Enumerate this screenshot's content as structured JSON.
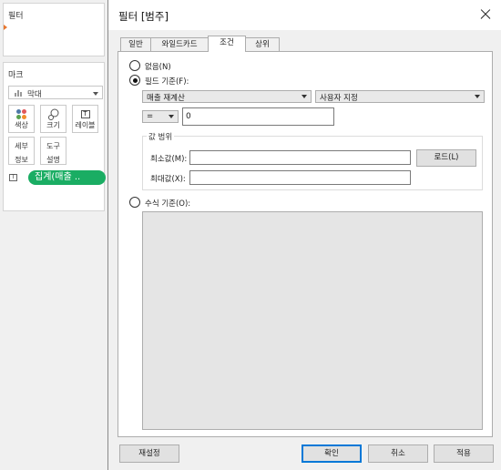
{
  "left": {
    "filter_title": "필터",
    "marks_title": "마크",
    "mark_type": "막대",
    "buttons": {
      "color": "색상",
      "size": "크기",
      "label": "레이블",
      "detail": [
        "세부",
        "정보"
      ],
      "tooltip": [
        "도구",
        "설명"
      ]
    },
    "pill_text": "집계(매출 ..",
    "pill_type_icon": "T",
    "label_icon": "T"
  },
  "dialog": {
    "title": "필터 [범주]",
    "tabs": [
      "일반",
      "와일드카드",
      "조건",
      "상위"
    ],
    "active_tab": "조건",
    "radio_none": "없음(N)",
    "radio_field": "필드 기준(F):",
    "field_select": "매출 재계산",
    "agg_select": "사용자 지정",
    "operator": "=",
    "value": "0",
    "range_title": "값 범위",
    "min_label": "최소값(M):",
    "max_label": "최대값(X):",
    "load_button": "로드(L)",
    "radio_formula": "수식 기준(O):",
    "reset_button": "재설정",
    "ok_button": "확인",
    "cancel_button": "취소",
    "apply_button": "적용"
  },
  "colors": {
    "pill": "#1aad63",
    "filter_accent": "#e8762d",
    "primary_border": "#0078d7"
  }
}
